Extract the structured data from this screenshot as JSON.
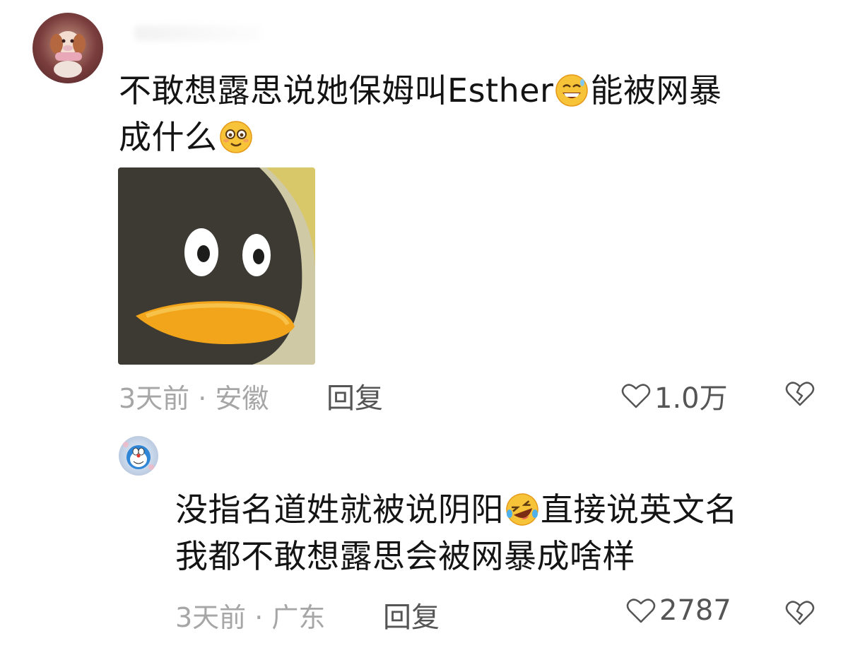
{
  "comments": [
    {
      "text_line1": "不敢想露思说她保姆叫Esther",
      "text_line1b": "能被网暴",
      "text_line2": "成什么",
      "emoji_1": "grin-sweat-emoji",
      "emoji_2": "flushed-smile-emoji",
      "sticker": "penguin-face-sticker",
      "meta": "3天前 · 安徽",
      "reply_label": "回复",
      "likes": "1.0万"
    },
    {
      "text_line1": "没指名道姓就被说阴阳",
      "text_line1b": "直接说英文名",
      "text_line2": "我都不敢想露思会被网暴成啥样",
      "emoji_1": "rofl-emoji",
      "meta": "3天前 · 广东",
      "reply_label": "回复",
      "likes": "2787"
    }
  ],
  "colors": {
    "meta_gray": "#a6a6a6",
    "action_gray": "#555555",
    "text": "#141414"
  }
}
